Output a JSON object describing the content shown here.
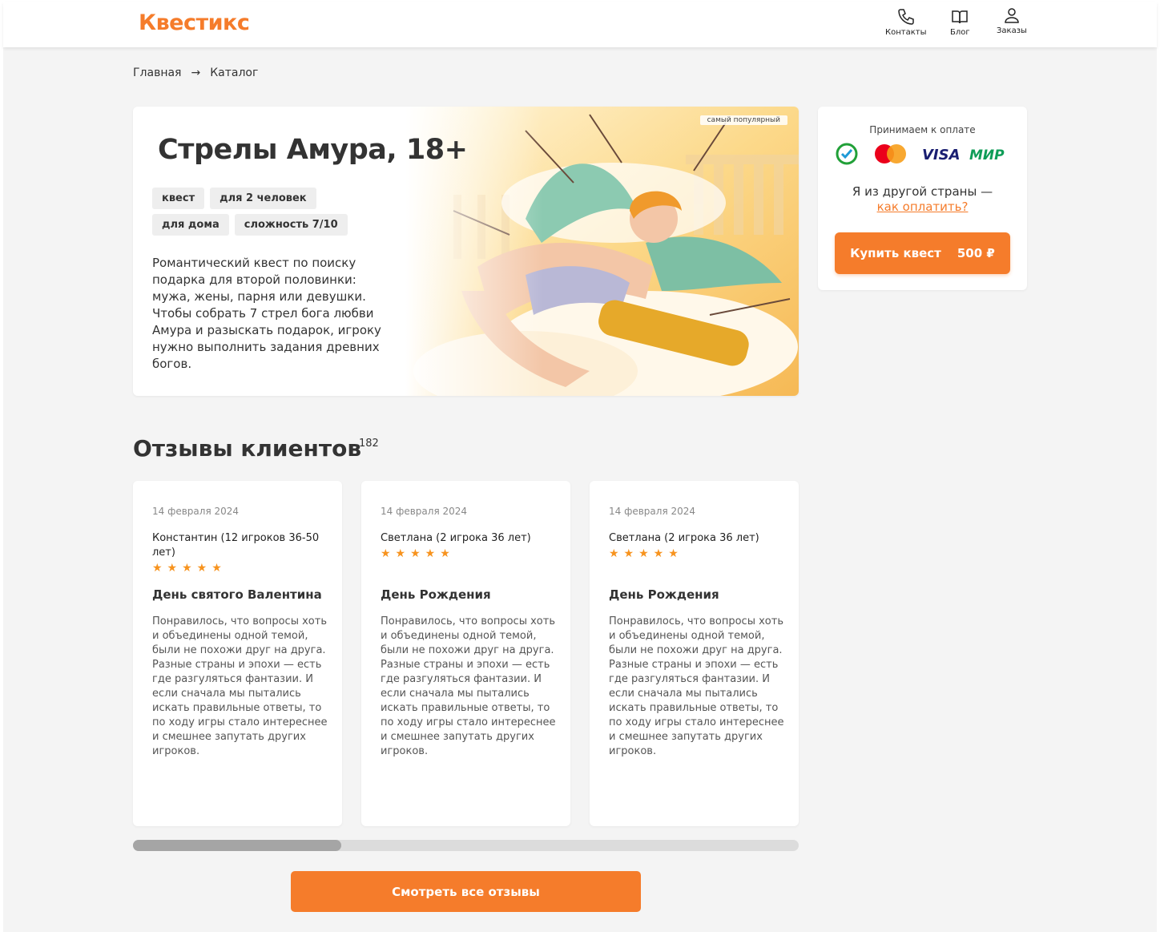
{
  "header": {
    "logo": "Квестикс",
    "nav": {
      "contacts": "Контакты",
      "blog": "Блог",
      "orders": "Заказы"
    }
  },
  "breadcrumb": {
    "home": "Главная",
    "separator": "→",
    "catalog": "Каталог"
  },
  "quest": {
    "title": "Стрелы Амура, 18+",
    "badge": "самый популярный",
    "tags": [
      "квест",
      "для 2 человек",
      "для дома",
      "сложность 7/10"
    ],
    "description": "Романтический квест по поиску подарка для второй половинки: мужа, жены, парня или девушки. Чтобы собрать 7 стрел бога любви Амура и разыскать подарок, игроку нужно выполнить задания древних богов."
  },
  "payment": {
    "title": "Принимаем к оплате",
    "methods": [
      "sber-icon",
      "mastercard-icon",
      "VISA",
      "МИР"
    ],
    "other_country": "Я из другой страны —",
    "how_to_pay": "как оплатить?",
    "buy_label": "Купить квест",
    "price": "500 ₽"
  },
  "reviews": {
    "title": "Отзывы клиентов",
    "count": "182",
    "items": [
      {
        "date": "14 февраля 2024",
        "author": "Константин (12 игроков 36-50 лет)",
        "rating": 5,
        "heading": "День святого Валентина",
        "text": "Понравилось, что вопросы хоть и объединены одной темой, были не похожи друг на друга. Разные страны и эпохи — есть где разгуляться фантазии. И если сначала мы пытались искать правильные ответы, то по ходу игры стало интереснее и смешнее запутать других игроков."
      },
      {
        "date": "14 февраля 2024",
        "author": "Светлана (2 игрока 36 лет)",
        "rating": 5,
        "heading": "День Рождения",
        "text": "Понравилось, что вопросы хоть и объединены одной темой, были не похожи друг на друга. Разные страны и эпохи — есть где разгуляться фантазии. И если сначала мы пытались искать правильные ответы, то по ходу игры стало интереснее и смешнее запутать других игроков."
      },
      {
        "date": "14 февраля 2024",
        "author": "Светлана (2 игрока 36 лет)",
        "rating": 5,
        "heading": "День Рождения",
        "text": "Понравилось, что вопросы хоть и объединены одной темой, были не похожи друг на друга. Разные страны и эпохи — есть где разгуляться фантазии. И если сначала мы пытались искать правильные ответы, то по ходу игры стало интереснее и смешнее запутать других игроков."
      }
    ],
    "scroll_position": 0.0,
    "all_button": "Смотреть все отзывы"
  },
  "colors": {
    "accent": "#f57c2b",
    "star": "#f7931e",
    "background": "#f4f4f4"
  }
}
